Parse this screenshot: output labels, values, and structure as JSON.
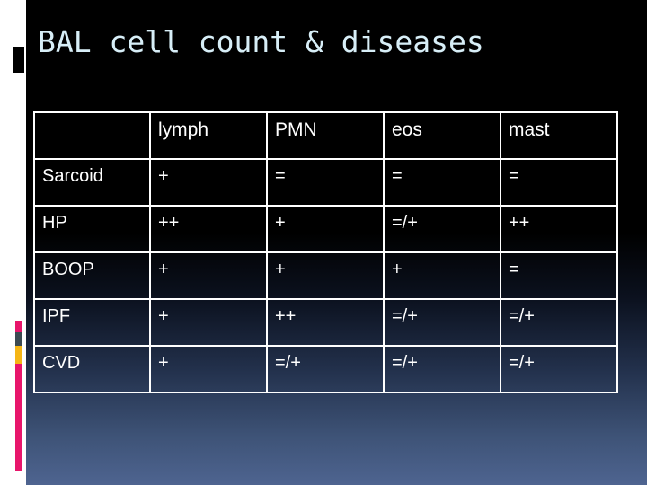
{
  "slide": {
    "title": "BAL cell count & diseases",
    "title_color": "#d7eef7",
    "background_top_color": "#000000",
    "background_bottom_color": "#4e6490",
    "left_band_color": "#ffffff",
    "accent_block_color": "#000000"
  },
  "decoration": {
    "bar_segments": [
      {
        "name": "magenta-top",
        "color": "#e8156b"
      },
      {
        "name": "slate",
        "color": "#3c4a52"
      },
      {
        "name": "orange",
        "color": "#f5b515"
      },
      {
        "name": "magenta-bottom",
        "color": "#e8156b"
      }
    ]
  },
  "table": {
    "border_color": "#ffffff",
    "text_color": "#ffffff",
    "headers": [
      "",
      "lymph",
      "PMN",
      "eos",
      "mast"
    ],
    "rows": [
      {
        "disease": "Sarcoid",
        "lymph": "+",
        "pmn": "=",
        "eos": "=",
        "mast": "="
      },
      {
        "disease": "HP",
        "lymph": "++",
        "pmn": "+",
        "eos": "=/+",
        "mast": "++"
      },
      {
        "disease": "BOOP",
        "lymph": "+",
        "pmn": "+",
        "eos": "+",
        "mast": "="
      },
      {
        "disease": "IPF",
        "lymph": "+",
        "pmn": "++",
        "eos": "=/+",
        "mast": "=/+"
      },
      {
        "disease": "CVD",
        "lymph": "+",
        "pmn": "=/+",
        "eos": "=/+",
        "mast": "=/+"
      }
    ]
  }
}
